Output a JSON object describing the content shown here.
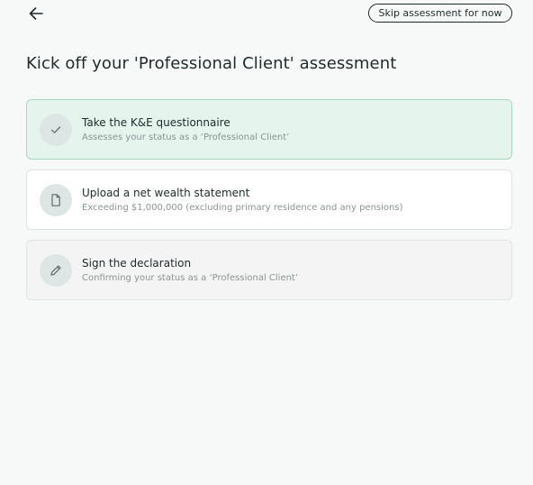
{
  "header": {
    "back_label": "",
    "skip_label": "Skip assessment for now"
  },
  "page": {
    "title": "Kick off your 'Professional Client' assessment"
  },
  "steps": [
    {
      "title": "Take the K&E questionnaire",
      "subtitle": "Assesses your status as a ‘Professional Client’",
      "icon": "check-icon",
      "status": "complete"
    },
    {
      "title": "Upload a net wealth statement",
      "subtitle": "Exceeding $1,000,000 (excluding primary residence and any pensions)",
      "icon": "document-icon",
      "status": "active"
    },
    {
      "title": "Sign the declaration",
      "subtitle": "Confirming your status as a ‘Professional Client’",
      "icon": "pencil-icon",
      "status": "disabled"
    }
  ],
  "colors": {
    "background": "#f7f9f8",
    "complete_card": "#e5f5ee",
    "complete_border": "#a8d8c0",
    "disabled_card": "#f4f4f4",
    "icon_circle": "#dde6e4",
    "text": "#1f2a2a",
    "muted_text": "#8b9392"
  }
}
